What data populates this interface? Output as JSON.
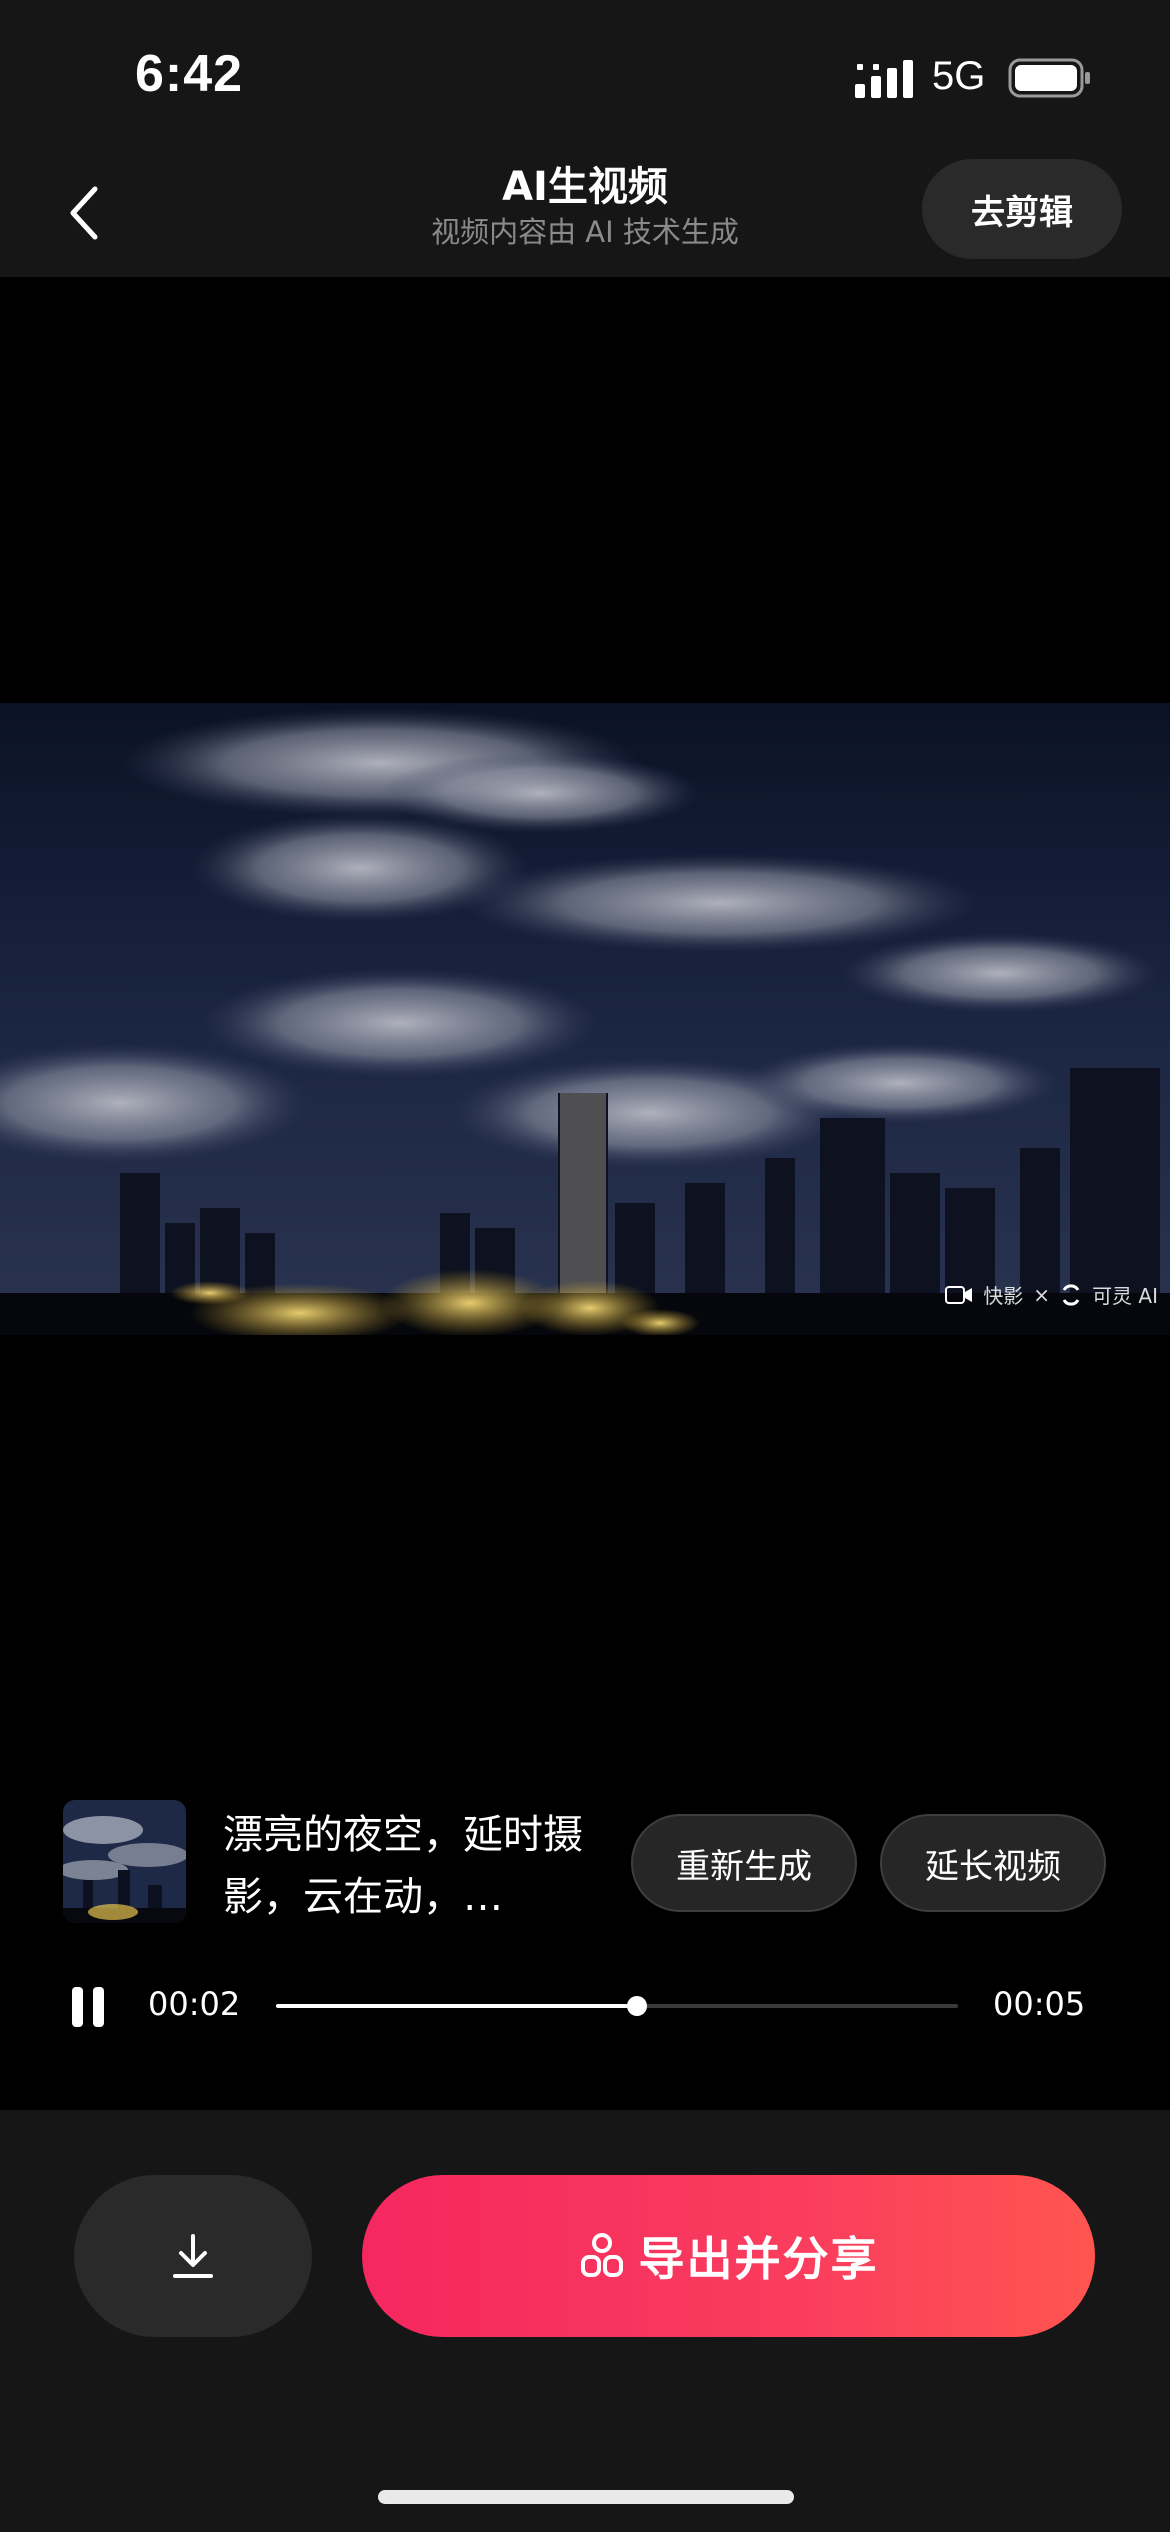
{
  "status_bar": {
    "time": "6:42",
    "network": "5G",
    "icons": [
      "signal-icon",
      "battery-icon"
    ]
  },
  "nav": {
    "back_icon": "chevron-left-icon",
    "title": "AI生视频",
    "subtitle": "视频内容由 AI 技术生成",
    "edit_label": "去剪辑"
  },
  "video": {
    "watermark_app": "快影",
    "watermark_separator": "×",
    "watermark_ai": "可灵 AI"
  },
  "prompt": {
    "text": "漂亮的夜空，延时摄影，云在动，…",
    "regenerate_label": "重新生成",
    "extend_label": "延长视频"
  },
  "playback": {
    "state_icon": "pause-icon",
    "current_time": "00:02",
    "total_time": "00:05",
    "progress": 0.53
  },
  "actions": {
    "download_icon": "download-icon",
    "export_icon": "share-icon",
    "export_label": "导出并分享"
  },
  "colors": {
    "background": "#161616",
    "player_background": "#000000",
    "accent_start": "#f5275f",
    "accent_end": "#ff5550",
    "button_dark": "#2a2a2a"
  }
}
